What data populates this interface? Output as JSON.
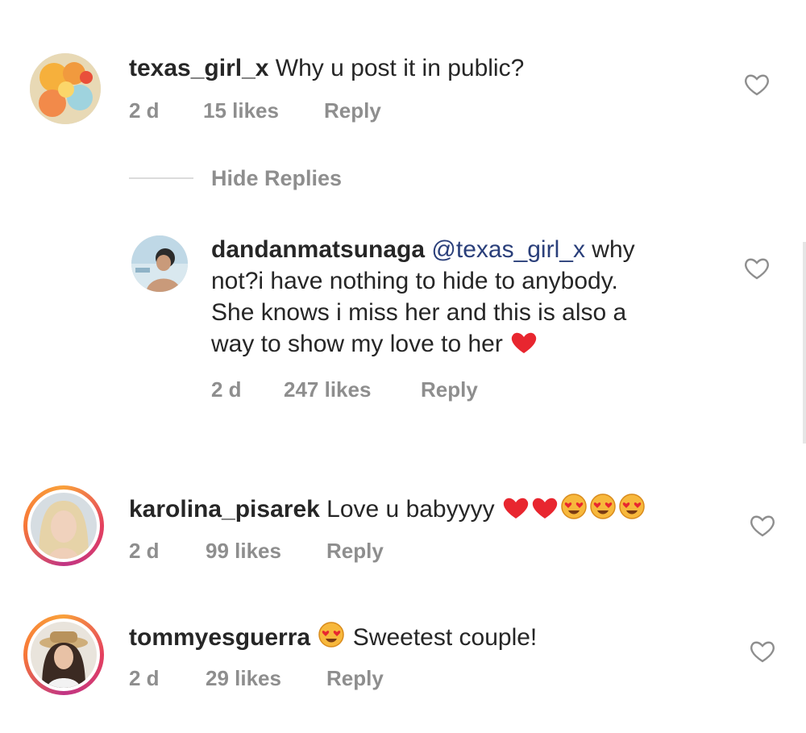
{
  "comments": [
    {
      "username": "texas_girl_x",
      "text": "Why u post it in public?",
      "time": "2 d",
      "likes": "15 likes",
      "reply": "Reply"
    },
    {
      "username": "karolina_pisarek",
      "text": "Love u babyyyy",
      "time": "2 d",
      "likes": "99 likes",
      "reply": "Reply"
    },
    {
      "username": "tommyesguerra",
      "text": "Sweetest couple!",
      "time": "2 d",
      "likes": "29 likes",
      "reply": "Reply"
    }
  ],
  "hide_replies": "Hide Replies",
  "reply_comment": {
    "username": "dandanmatsunaga",
    "mention": "@texas_girl_x",
    "line1_tail": "why",
    "line2": "not?i have nothing to hide to anybody.",
    "line3": "She knows i miss her and this is also a",
    "line4": "way to show my love to her",
    "time": "2 d",
    "likes": "247 likes",
    "reply": "Reply"
  },
  "icons": {
    "like": "heart-outline-icon",
    "emoji_heart": "red-heart-emoji",
    "emoji_face": "heart-eyes-emoji"
  },
  "colors": {
    "text": "#262626",
    "meta": "#8e8e8e",
    "mention": "#2a3f7a",
    "heart": "#ed4956"
  }
}
